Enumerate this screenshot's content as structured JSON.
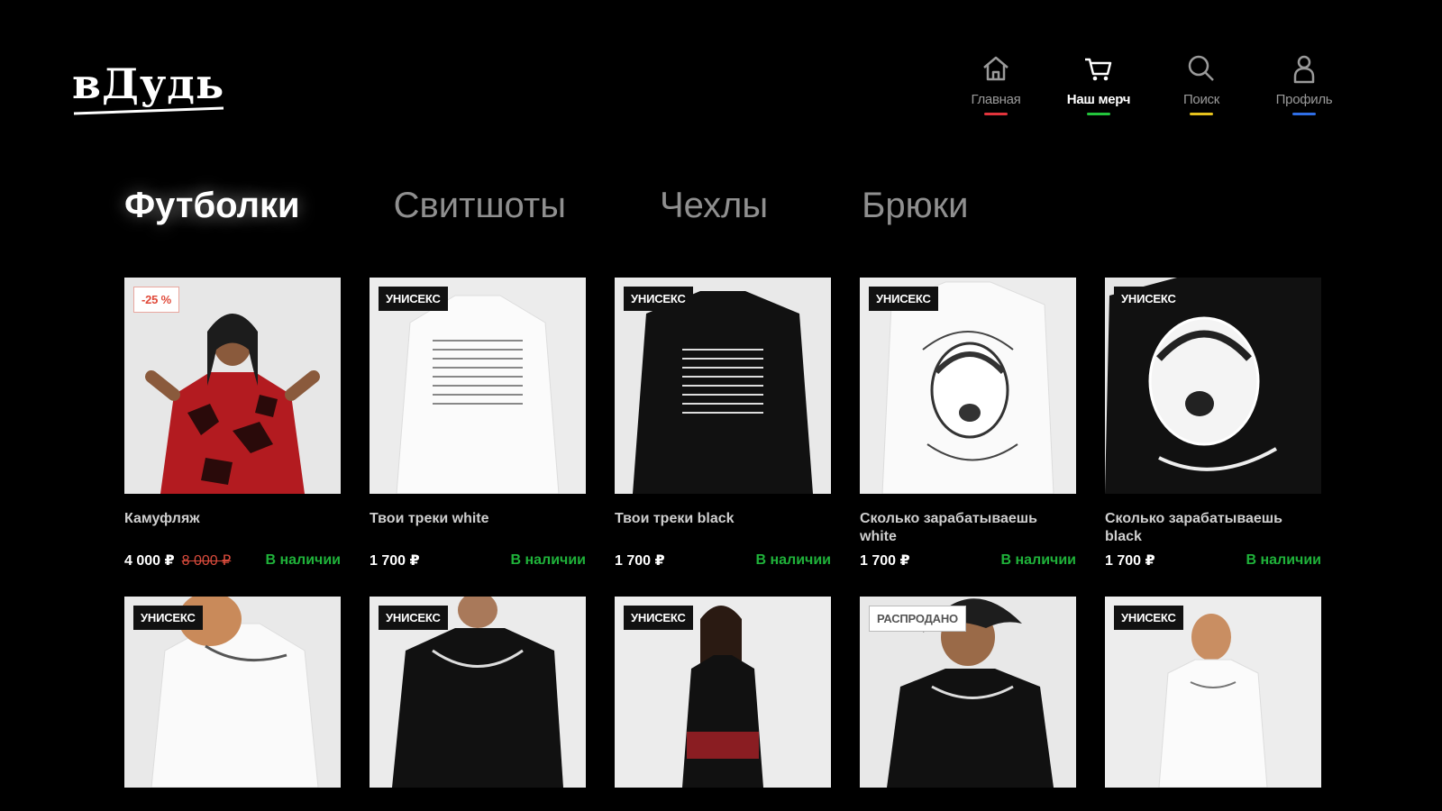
{
  "logo": {
    "text": "вДудь"
  },
  "nav": [
    {
      "label": "Главная",
      "icon": "home-icon",
      "color": "#e2343c",
      "active": false
    },
    {
      "label": "Наш мерч",
      "icon": "cart-icon",
      "color": "#23c43c",
      "active": true
    },
    {
      "label": "Поиск",
      "icon": "search-icon",
      "color": "#e6c21d",
      "active": false
    },
    {
      "label": "Профиль",
      "icon": "profile-icon",
      "color": "#2f6ee6",
      "active": false
    }
  ],
  "tabs": [
    "Футболки",
    "Свитшоты",
    "Чехлы",
    "Брюки"
  ],
  "active_tab": "Футболки",
  "products": [
    {
      "badge": "-25 %",
      "title": "Камуфляж",
      "price": "4 000 ₽",
      "old_price": "8 000 ₽",
      "stock": "В наличии"
    },
    {
      "badge": "УНИСЕКС",
      "title": "Твои треки white",
      "price": "1 700 ₽",
      "stock": "В наличии"
    },
    {
      "badge": "УНИСЕКС",
      "title": "Твои треки black",
      "price": "1 700 ₽",
      "stock": "В наличии"
    },
    {
      "badge": "УНИСЕКС",
      "title": "Сколько зарабатываешь white",
      "price": "1 700 ₽",
      "stock": "В наличии"
    },
    {
      "badge": "УНИСЕКС",
      "title": "Сколько зарабатываешь black",
      "price": "1 700 ₽",
      "stock": "В наличии"
    }
  ],
  "products_row2": [
    {
      "badge": "УНИСЕКС"
    },
    {
      "badge": "УНИСЕКС"
    },
    {
      "badge": "УНИСЕКС"
    },
    {
      "badge": "РАСПРОДАНО"
    },
    {
      "badge": "УНИСЕКС"
    }
  ],
  "colors": {
    "accent_green": "#1fb23a",
    "sale_red": "#d94b3c"
  }
}
